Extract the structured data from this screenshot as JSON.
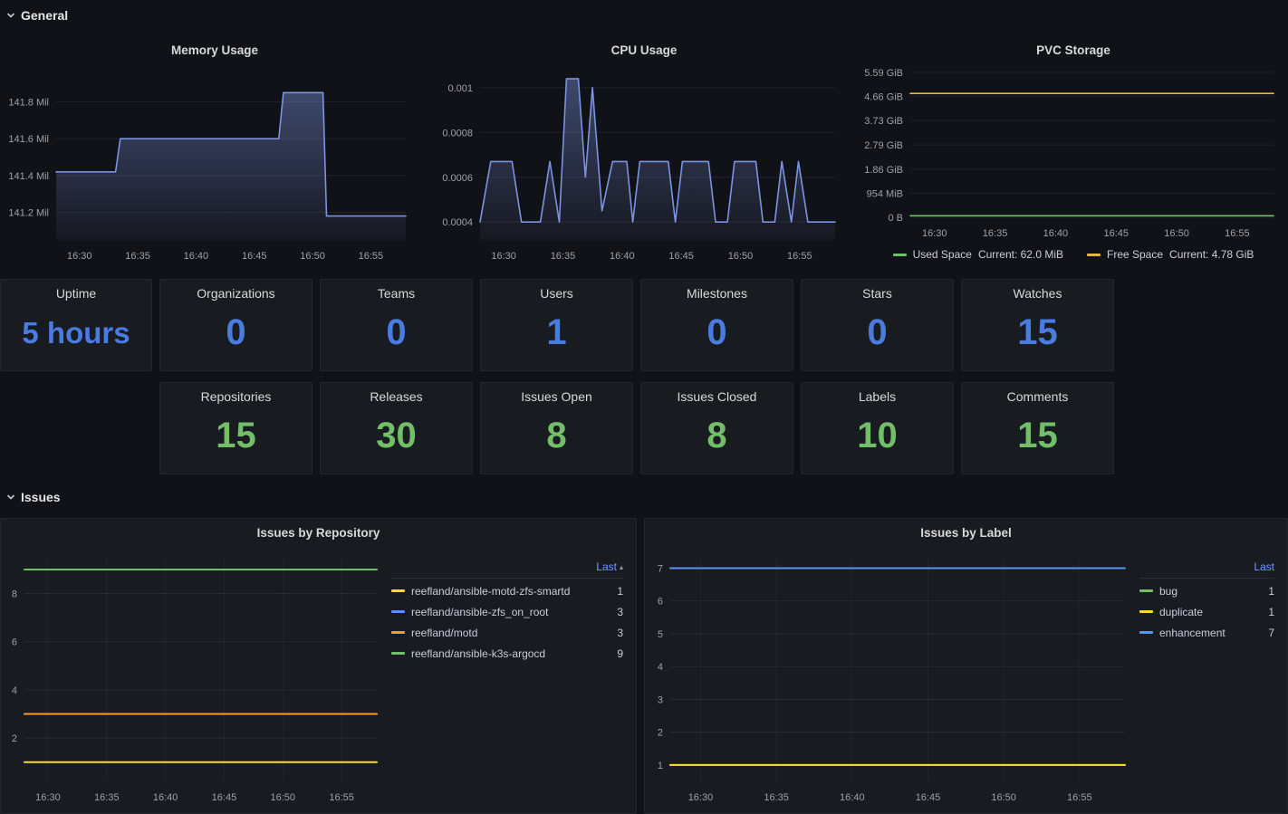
{
  "sections": {
    "general": "General",
    "issues": "Issues"
  },
  "colors": {
    "stat_blue": "#4a7be0",
    "stat_green": "#73bf69"
  },
  "stats_row1": [
    {
      "title": "Uptime",
      "value": "5 hours"
    },
    {
      "title": "Organizations",
      "value": "0"
    },
    {
      "title": "Teams",
      "value": "0"
    },
    {
      "title": "Users",
      "value": "1"
    },
    {
      "title": "Milestones",
      "value": "0"
    },
    {
      "title": "Stars",
      "value": "0"
    },
    {
      "title": "Watches",
      "value": "15"
    }
  ],
  "stats_row2": [
    {
      "title": "Repositories",
      "value": "15"
    },
    {
      "title": "Releases",
      "value": "30"
    },
    {
      "title": "Issues Open",
      "value": "8"
    },
    {
      "title": "Issues Closed",
      "value": "8"
    },
    {
      "title": "Labels",
      "value": "10"
    },
    {
      "title": "Comments",
      "value": "15"
    }
  ],
  "pvc_legend": [
    {
      "name": "Used Space",
      "current": "Current: 62.0 MiB",
      "color": "#73bf69"
    },
    {
      "name": "Free Space",
      "current": "Current: 4.78 GiB",
      "color": "#eab839"
    }
  ],
  "legends": {
    "repo": {
      "header": "Last",
      "items": [
        {
          "name": "reefland/ansible-motd-zfs-smartd",
          "value": "1",
          "color": "#fade2a"
        },
        {
          "name": "reefland/ansible-zfs_on_root",
          "value": "3",
          "color": "#5794f2"
        },
        {
          "name": "reefland/motd",
          "value": "3",
          "color": "#ff9830"
        },
        {
          "name": "reefland/ansible-k3s-argocd",
          "value": "9",
          "color": "#73bf69"
        }
      ]
    },
    "label": {
      "header": "Last",
      "items": [
        {
          "name": "bug",
          "value": "1",
          "color": "#73bf69"
        },
        {
          "name": "duplicate",
          "value": "1",
          "color": "#fade2a"
        },
        {
          "name": "enhancement",
          "value": "7",
          "color": "#5794f2"
        }
      ]
    }
  },
  "chart_data": [
    {
      "id": "memory",
      "type": "area",
      "title": "Memory Usage",
      "x_range": [
        0,
        30
      ],
      "y_range": [
        141.05,
        141.95
      ],
      "grid": "horizontal",
      "legend_position": "none",
      "y_ticks": [
        {
          "v": 141.2,
          "label": "141.2 Mil"
        },
        {
          "v": 141.4,
          "label": "141.4 Mil"
        },
        {
          "v": 141.6,
          "label": "141.6 Mil"
        },
        {
          "v": 141.8,
          "label": "141.8 Mil"
        }
      ],
      "x_ticks": [
        {
          "v": 2,
          "label": "16:30"
        },
        {
          "v": 7,
          "label": "16:35"
        },
        {
          "v": 12,
          "label": "16:40"
        },
        {
          "v": 17,
          "label": "16:45"
        },
        {
          "v": 22,
          "label": "16:50"
        },
        {
          "v": 27,
          "label": "16:55"
        }
      ],
      "series": [
        {
          "name": "memory",
          "color": "#7b93e0",
          "fill": true,
          "points": [
            [
              0,
              141.42
            ],
            [
              5.1,
              141.42
            ],
            [
              5.5,
              141.6
            ],
            [
              19.1,
              141.6
            ],
            [
              19.5,
              141.85
            ],
            [
              22.9,
              141.85
            ],
            [
              23.2,
              141.18
            ],
            [
              30,
              141.18
            ]
          ]
        }
      ]
    },
    {
      "id": "cpu",
      "type": "area",
      "title": "CPU Usage",
      "x_range": [
        0,
        30
      ],
      "y_range": [
        0.00032,
        0.00106
      ],
      "grid": "horizontal",
      "legend_position": "none",
      "y_ticks": [
        {
          "v": 0.0004,
          "label": "0.0004"
        },
        {
          "v": 0.0006,
          "label": "0.0006"
        },
        {
          "v": 0.0008,
          "label": "0.0008"
        },
        {
          "v": 0.001,
          "label": "0.001"
        }
      ],
      "x_ticks": [
        {
          "v": 2,
          "label": "16:30"
        },
        {
          "v": 7,
          "label": "16:35"
        },
        {
          "v": 12,
          "label": "16:40"
        },
        {
          "v": 17,
          "label": "16:45"
        },
        {
          "v": 22,
          "label": "16:50"
        },
        {
          "v": 27,
          "label": "16:55"
        }
      ],
      "series": [
        {
          "name": "cpu",
          "color": "#7b93e0",
          "fill": true,
          "points": [
            [
              0,
              0.0004
            ],
            [
              0.9,
              0.00067
            ],
            [
              2.7,
              0.00067
            ],
            [
              3.5,
              0.0004
            ],
            [
              5.1,
              0.0004
            ],
            [
              5.9,
              0.00067
            ],
            [
              6.7,
              0.0004
            ],
            [
              7.3,
              0.00104
            ],
            [
              8.3,
              0.00104
            ],
            [
              8.9,
              0.0006
            ],
            [
              9.5,
              0.001
            ],
            [
              10.3,
              0.00045
            ],
            [
              11.2,
              0.00067
            ],
            [
              12.4,
              0.00067
            ],
            [
              12.9,
              0.0004
            ],
            [
              13.5,
              0.00067
            ],
            [
              15.9,
              0.00067
            ],
            [
              16.5,
              0.0004
            ],
            [
              17.1,
              0.00067
            ],
            [
              19.3,
              0.00067
            ],
            [
              19.9,
              0.0004
            ],
            [
              20.9,
              0.0004
            ],
            [
              21.5,
              0.00067
            ],
            [
              23.3,
              0.00067
            ],
            [
              23.9,
              0.0004
            ],
            [
              24.9,
              0.0004
            ],
            [
              25.5,
              0.00067
            ],
            [
              26.3,
              0.0004
            ],
            [
              26.9,
              0.00067
            ],
            [
              27.7,
              0.0004
            ],
            [
              30,
              0.0004
            ]
          ]
        }
      ]
    },
    {
      "id": "pvc",
      "type": "line",
      "title": "PVC Storage",
      "x_range": [
        0,
        30
      ],
      "y_range": [
        0,
        5.59
      ],
      "grid": "horizontal",
      "legend_position": "bottom",
      "y_ticks": [
        {
          "v": 0,
          "label": "0 B"
        },
        {
          "v": 0.931,
          "label": "954 MiB"
        },
        {
          "v": 1.86,
          "label": "1.86 GiB"
        },
        {
          "v": 2.79,
          "label": "2.79 GiB"
        },
        {
          "v": 3.73,
          "label": "3.73 GiB"
        },
        {
          "v": 4.66,
          "label": "4.66 GiB"
        },
        {
          "v": 5.59,
          "label": "5.59 GiB"
        }
      ],
      "x_ticks": [
        {
          "v": 2,
          "label": "16:30"
        },
        {
          "v": 7,
          "label": "16:35"
        },
        {
          "v": 12,
          "label": "16:40"
        },
        {
          "v": 17,
          "label": "16:45"
        },
        {
          "v": 22,
          "label": "16:50"
        },
        {
          "v": 27,
          "label": "16:55"
        }
      ],
      "series": [
        {
          "name": "Used Space",
          "color": "#73bf69",
          "fill": false,
          "points": [
            [
              0,
              0.0605
            ],
            [
              30,
              0.0605
            ]
          ]
        },
        {
          "name": "Free Space",
          "color": "#eab839",
          "fill": false,
          "points": [
            [
              0,
              4.78
            ],
            [
              30,
              4.78
            ]
          ]
        }
      ]
    },
    {
      "id": "repo",
      "type": "line",
      "title": "Issues by Repository",
      "x_range": [
        0,
        30
      ],
      "y_range": [
        0.2,
        9.6
      ],
      "grid": "both",
      "legend_position": "right",
      "y_ticks": [
        {
          "v": 2,
          "label": "2"
        },
        {
          "v": 4,
          "label": "4"
        },
        {
          "v": 6,
          "label": "6"
        },
        {
          "v": 8,
          "label": "8"
        }
      ],
      "x_ticks": [
        {
          "v": 2,
          "label": "16:30"
        },
        {
          "v": 7,
          "label": "16:35"
        },
        {
          "v": 12,
          "label": "16:40"
        },
        {
          "v": 17,
          "label": "16:45"
        },
        {
          "v": 22,
          "label": "16:50"
        },
        {
          "v": 27,
          "label": "16:55"
        }
      ],
      "series": [
        {
          "name": "reefland/ansible-zfs_on_root",
          "color": "#5794f2",
          "fill": false,
          "points": [
            [
              0,
              3
            ],
            [
              30,
              3
            ]
          ]
        },
        {
          "name": "reefland/motd",
          "color": "#ff9830",
          "fill": false,
          "points": [
            [
              0,
              3
            ],
            [
              30,
              3
            ]
          ]
        },
        {
          "name": "reefland/ansible-motd-zfs-smartd",
          "color": "#fade2a",
          "fill": false,
          "points": [
            [
              0,
              1
            ],
            [
              30,
              1
            ]
          ]
        },
        {
          "name": "reefland/ansible-k3s-argocd",
          "color": "#73bf69",
          "fill": false,
          "points": [
            [
              0,
              9
            ],
            [
              30,
              9
            ]
          ]
        }
      ]
    },
    {
      "id": "label",
      "type": "line",
      "title": "Issues by Label",
      "x_range": [
        0,
        30
      ],
      "y_range": [
        0.5,
        7.4
      ],
      "grid": "both",
      "legend_position": "right",
      "y_ticks": [
        {
          "v": 1,
          "label": "1"
        },
        {
          "v": 2,
          "label": "2"
        },
        {
          "v": 3,
          "label": "3"
        },
        {
          "v": 4,
          "label": "4"
        },
        {
          "v": 5,
          "label": "5"
        },
        {
          "v": 6,
          "label": "6"
        },
        {
          "v": 7,
          "label": "7"
        }
      ],
      "x_ticks": [
        {
          "v": 2,
          "label": "16:30"
        },
        {
          "v": 7,
          "label": "16:35"
        },
        {
          "v": 12,
          "label": "16:40"
        },
        {
          "v": 17,
          "label": "16:45"
        },
        {
          "v": 22,
          "label": "16:50"
        },
        {
          "v": 27,
          "label": "16:55"
        }
      ],
      "series": [
        {
          "name": "enhancement",
          "color": "#5794f2",
          "fill": false,
          "points": [
            [
              0,
              7
            ],
            [
              30,
              7
            ]
          ]
        },
        {
          "name": "bug",
          "color": "#73bf69",
          "fill": false,
          "points": [
            [
              0,
              1
            ],
            [
              30,
              1
            ]
          ]
        },
        {
          "name": "duplicate",
          "color": "#fade2a",
          "fill": false,
          "points": [
            [
              0,
              1
            ],
            [
              30,
              1
            ]
          ]
        }
      ]
    }
  ]
}
